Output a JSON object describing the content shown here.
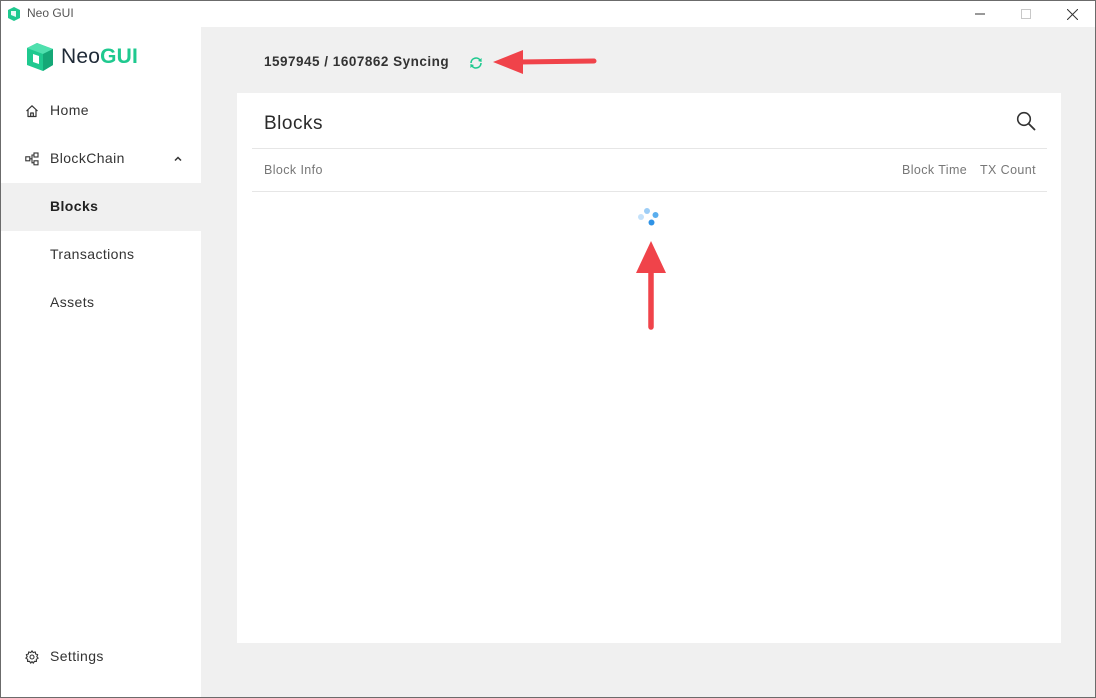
{
  "window": {
    "title": "Neo GUI",
    "controls": [
      "minimize",
      "maximize",
      "close"
    ]
  },
  "brand": {
    "name_part1": "Neo",
    "name_part2": "GUI",
    "accent_color": "#1fc98f"
  },
  "sidebar": {
    "items": [
      {
        "label": "Home",
        "icon": "home-icon"
      },
      {
        "label": "BlockChain",
        "icon": "blockchain-icon",
        "expanded": true
      },
      {
        "label": "Blocks",
        "active": true
      },
      {
        "label": "Transactions"
      },
      {
        "label": "Assets"
      }
    ],
    "settings": {
      "label": "Settings",
      "icon": "gear-icon"
    }
  },
  "status": {
    "current_block": "1597945",
    "target_block": "1607862",
    "text": "1597945 / 1607862 Syncing",
    "icon": "sync-icon"
  },
  "page": {
    "title": "Blocks",
    "columns": {
      "block_info": "Block Info",
      "block_time": "Block Time",
      "tx_count": "TX Count"
    },
    "loading": true
  },
  "annotations": {
    "arrow_color": "#f0434a"
  }
}
